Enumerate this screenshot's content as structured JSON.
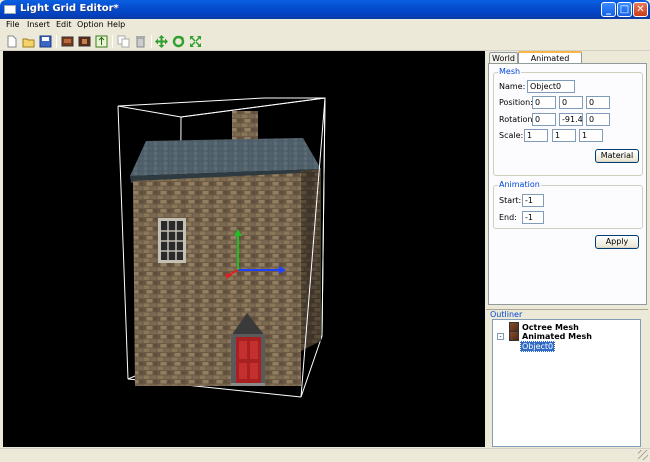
{
  "window": {
    "title": "Light Grid Editor*",
    "minimize": "_",
    "maximize": "□",
    "close": "✕"
  },
  "menu": [
    "File",
    "Insert",
    "Edit",
    "Option",
    "Help"
  ],
  "toolbar_icons": [
    "new-icon",
    "open-icon",
    "save-icon",
    "octree-icon",
    "mesh-icon",
    "export-icon",
    "copy-icon",
    "delete-icon",
    "move-icon",
    "rotate-icon",
    "scale-icon"
  ],
  "tabs": {
    "world": "World",
    "animated_mesh": "Animated Mesh"
  },
  "mesh": {
    "group_title": "Mesh",
    "name_label": "Name:",
    "name_value": "Object0",
    "position_label": "Position:",
    "position": [
      "0",
      "0",
      "0"
    ],
    "rotation_label": "Rotation:",
    "rotation": [
      "0",
      "-91.4",
      "0"
    ],
    "scale_label": "Scale:",
    "scale": [
      "1",
      "1",
      "1"
    ],
    "material_button": "Material"
  },
  "animation": {
    "group_title": "Animation",
    "start_label": "Start:",
    "start_value": "-1",
    "end_label": "End:",
    "end_value": "-1"
  },
  "apply_button": "Apply",
  "outliner": {
    "title": "Outliner",
    "items": [
      {
        "label": "Octree Mesh"
      },
      {
        "label": "Animated Mesh",
        "expander": "-",
        "children": [
          "Object0"
        ]
      }
    ]
  },
  "colors": {
    "accent": "#0046d5",
    "selection": "#316ac5",
    "axis_x": "#2040ff",
    "axis_y": "#20c020",
    "axis_z": "#e02020"
  }
}
